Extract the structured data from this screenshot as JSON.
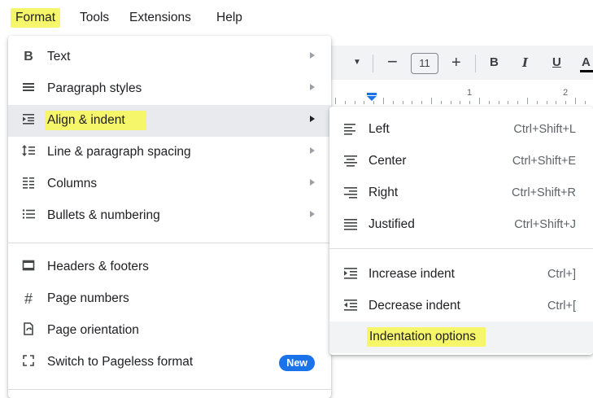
{
  "menubar": {
    "items": [
      "Format",
      "Tools",
      "Extensions",
      "Help"
    ]
  },
  "toolbar": {
    "font_size": "11",
    "bold": "B",
    "italic": "I",
    "underline": "U",
    "text_color": "A",
    "minus": "−",
    "plus": "+"
  },
  "ruler": {
    "numbers": [
      "1",
      "2"
    ]
  },
  "format_menu": {
    "items": [
      {
        "label": "Text",
        "icon": "bold-icon"
      },
      {
        "label": "Paragraph styles",
        "icon": "paragraph-styles-icon"
      },
      {
        "label": "Align & indent",
        "icon": "align-indent-icon"
      },
      {
        "label": "Line & paragraph spacing",
        "icon": "line-spacing-icon"
      },
      {
        "label": "Columns",
        "icon": "columns-icon"
      },
      {
        "label": "Bullets & numbering",
        "icon": "bullets-icon"
      },
      {
        "label": "Headers & footers",
        "icon": "headers-footers-icon"
      },
      {
        "label": "Page numbers",
        "icon": "hash-icon"
      },
      {
        "label": "Page orientation",
        "icon": "page-orientation-icon"
      },
      {
        "label": "Switch to Pageless format",
        "icon": "pageless-icon"
      }
    ],
    "new_badge": "New"
  },
  "align_submenu": {
    "items": [
      {
        "label": "Left",
        "shortcut": "Ctrl+Shift+L"
      },
      {
        "label": "Center",
        "shortcut": "Ctrl+Shift+E"
      },
      {
        "label": "Right",
        "shortcut": "Ctrl+Shift+R"
      },
      {
        "label": "Justified",
        "shortcut": "Ctrl+Shift+J"
      },
      {
        "label": "Increase indent",
        "shortcut": "Ctrl+]"
      },
      {
        "label": "Decrease indent",
        "shortcut": "Ctrl+["
      },
      {
        "label": "Indentation options",
        "shortcut": ""
      }
    ]
  },
  "colors": {
    "highlight": "#f6f66a",
    "badge": "#1a73e8",
    "hover": "#e8eaed",
    "ruler_marker": "#1a73e8"
  }
}
